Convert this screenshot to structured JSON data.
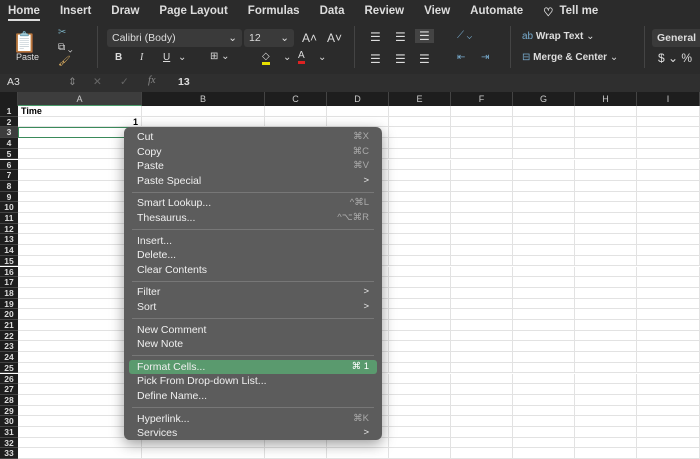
{
  "tabs": [
    "Home",
    "Insert",
    "Draw",
    "Page Layout",
    "Formulas",
    "Data",
    "Review",
    "View",
    "Automate",
    "Tell me"
  ],
  "ribbon": {
    "paste": "Paste",
    "font": "Calibri (Body)",
    "size": "12",
    "bold": "B",
    "italic": "I",
    "underline": "U",
    "wrap": "Wrap Text",
    "merge": "Merge & Center",
    "number_format": "General",
    "currency": "$"
  },
  "formula": {
    "name_box": "A3",
    "fx": "fx",
    "value": "13"
  },
  "columns": [
    "A",
    "B",
    "C",
    "D",
    "E",
    "F",
    "G",
    "H",
    "I"
  ],
  "cells": {
    "a1": "Time",
    "a2": "1"
  },
  "menu": [
    [
      {
        "label": "Cut",
        "sc": "⌘X"
      },
      {
        "label": "Copy",
        "sc": "⌘C"
      },
      {
        "label": "Paste",
        "sc": "⌘V"
      },
      {
        "label": "Paste Special",
        "sc": ">"
      }
    ],
    [
      {
        "label": "Smart Lookup...",
        "sc": "^⌘L"
      },
      {
        "label": "Thesaurus...",
        "sc": "^⌥⌘R"
      }
    ],
    [
      {
        "label": "Insert...",
        "sc": ""
      },
      {
        "label": "Delete...",
        "sc": ""
      },
      {
        "label": "Clear Contents",
        "sc": ""
      }
    ],
    [
      {
        "label": "Filter",
        "sc": ">"
      },
      {
        "label": "Sort",
        "sc": ">"
      }
    ],
    [
      {
        "label": "New Comment",
        "sc": ""
      },
      {
        "label": "New Note",
        "sc": ""
      }
    ],
    [
      {
        "label": "Format Cells...",
        "sc": "⌘ 1",
        "hl": true
      },
      {
        "label": "Pick From Drop-down List...",
        "sc": ""
      },
      {
        "label": "Define Name...",
        "sc": ""
      }
    ],
    [
      {
        "label": "Hyperlink...",
        "sc": "⌘K"
      },
      {
        "label": "Services",
        "sc": ">"
      }
    ]
  ]
}
